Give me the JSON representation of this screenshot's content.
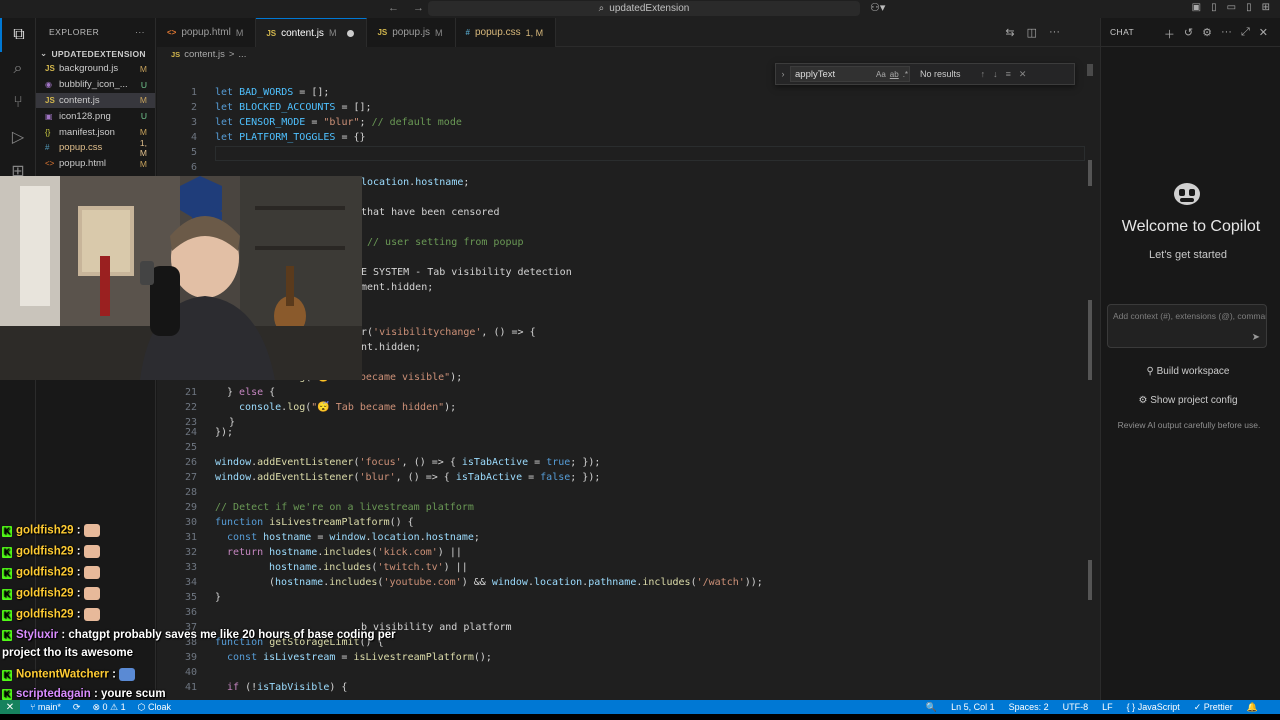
{
  "titlebar": {
    "search_text": "updatedExtension",
    "back": "←",
    "forward": "→"
  },
  "explorer": {
    "header": "EXPLORER",
    "more": "···",
    "folder": "UPDATEDEXTENSION",
    "files": [
      {
        "icon": "JS",
        "name": "background.js",
        "status": "M"
      },
      {
        "icon": "◉",
        "name": "bubblify_icon_...",
        "status": "U"
      },
      {
        "icon": "JS",
        "name": "content.js",
        "status": "M"
      },
      {
        "icon": "▣",
        "name": "icon128.png",
        "status": "U"
      },
      {
        "icon": "{}",
        "name": "manifest.json",
        "status": "M"
      },
      {
        "icon": "#",
        "name": "popup.css",
        "status": "1, M"
      },
      {
        "icon": "<>",
        "name": "popup.html",
        "status": "M"
      }
    ]
  },
  "tabs": [
    {
      "icon": "<>",
      "label": "popup.html",
      "mod": "M"
    },
    {
      "icon": "JS",
      "label": "content.js",
      "mod": "M"
    },
    {
      "icon": "JS",
      "label": "popup.js",
      "mod": "M"
    },
    {
      "icon": "#",
      "label": "popup.css",
      "mod": "1, M"
    }
  ],
  "breadcrumb": {
    "icon": "JS",
    "file": "content.js",
    "sep": ">",
    "symbol": "..."
  },
  "find": {
    "query": "applyText",
    "opt_case": "Aa",
    "opt_word": "ab",
    "opt_regex": ".*",
    "status": "No results"
  },
  "code_lines": [
    {
      "n": "1",
      "text": "let BAD_WORDS = [];"
    },
    {
      "n": "2",
      "text": "let BLOCKED_ACCOUNTS = [];"
    },
    {
      "n": "3",
      "text": "let CENSOR_MODE = \"blur\"; // default mode"
    },
    {
      "n": "4",
      "text": "let PLATFORM_TOGGLES = {}"
    },
    {
      "n": "5",
      "text": ""
    },
    {
      "n": "6",
      "text": ""
    },
    {
      "n": "",
      "text": "location.hostname;"
    },
    {
      "n": "",
      "text": "that have been censored"
    },
    {
      "n": "",
      "text": "// user setting from popup"
    },
    {
      "n": "",
      "text": "E SYSTEM - Tab visibility detection"
    },
    {
      "n": "",
      "text": "ment.hidden;"
    },
    {
      "n": "",
      "text": "r('visibilitychange', () => {"
    },
    {
      "n": "",
      "text": "nt.hidden;"
    },
    {
      "n": "20",
      "text": "console.log(\"😊 Tab became visible\");"
    },
    {
      "n": "21",
      "text": "} else {"
    },
    {
      "n": "22",
      "text": "console.log(\"😴 Tab became hidden\");"
    },
    {
      "n": "23",
      "text": "}"
    },
    {
      "n": "24",
      "text": "});"
    },
    {
      "n": "25",
      "text": ""
    },
    {
      "n": "26",
      "text": "window.addEventListener('focus', () => { isTabActive = true; });"
    },
    {
      "n": "27",
      "text": "window.addEventListener('blur', () => { isTabActive = false; });"
    },
    {
      "n": "28",
      "text": ""
    },
    {
      "n": "29",
      "text": "// Detect if we're on a livestream platform"
    },
    {
      "n": "30",
      "text": "function isLivestreamPlatform() {"
    },
    {
      "n": "31",
      "text": "const hostname = window.location.hostname;"
    },
    {
      "n": "32",
      "text": "return hostname.includes('kick.com') ||"
    },
    {
      "n": "33",
      "text": "hostname.includes('twitch.tv') ||"
    },
    {
      "n": "34",
      "text": "(hostname.includes('youtube.com') && window.location.pathname.includes('/watch'));"
    },
    {
      "n": "35",
      "text": "}"
    },
    {
      "n": "36",
      "text": ""
    },
    {
      "n": "37",
      "text": "b visibility and platform"
    },
    {
      "n": "38",
      "text": "function getStorageLimit() {"
    },
    {
      "n": "39",
      "text": "const isLivestream = isLivestreamPlatform();"
    },
    {
      "n": "40",
      "text": ""
    },
    {
      "n": "41",
      "text": "if (!isTabVisible) {"
    }
  ],
  "chat_overlay": [
    {
      "user": "goldfish29",
      "msg": ":"
    },
    {
      "user": "goldfish29",
      "msg": ":"
    },
    {
      "user": "goldfish29",
      "msg": ":"
    },
    {
      "user": "goldfish29",
      "msg": ":"
    },
    {
      "user": "goldfish29",
      "msg": ":"
    },
    {
      "user": "Styluxir",
      "msg": ": chatgpt probably saves me like 20 hours of base coding per"
    },
    {
      "user": "",
      "msg": "project tho its awesome"
    },
    {
      "user": "NontentWatcherr",
      "msg": ":"
    },
    {
      "user": "scriptedagain",
      "msg": ": youre scum"
    }
  ],
  "copilot": {
    "header": "CHAT",
    "welcome": "Welcome to Copilot",
    "start": "Let's get started",
    "input_placeholder": "Add context (#), extensions (@), commands",
    "send": "➤",
    "build_workspace": "Build workspace",
    "show_config": "Show project config",
    "review": "Review AI output carefully before use."
  },
  "statusbar": {
    "remote": "✕",
    "branch": "main*",
    "sync": "⟳",
    "errors": "⊗ 0  ⚠ 1",
    "cloak": "Cloak",
    "position": "Ln 5, Col 1",
    "spaces": "Spaces: 2",
    "encoding": "UTF-8",
    "eol": "LF",
    "language": "JavaScript",
    "prettier": "✓ Prettier",
    "bell": "🔔"
  }
}
